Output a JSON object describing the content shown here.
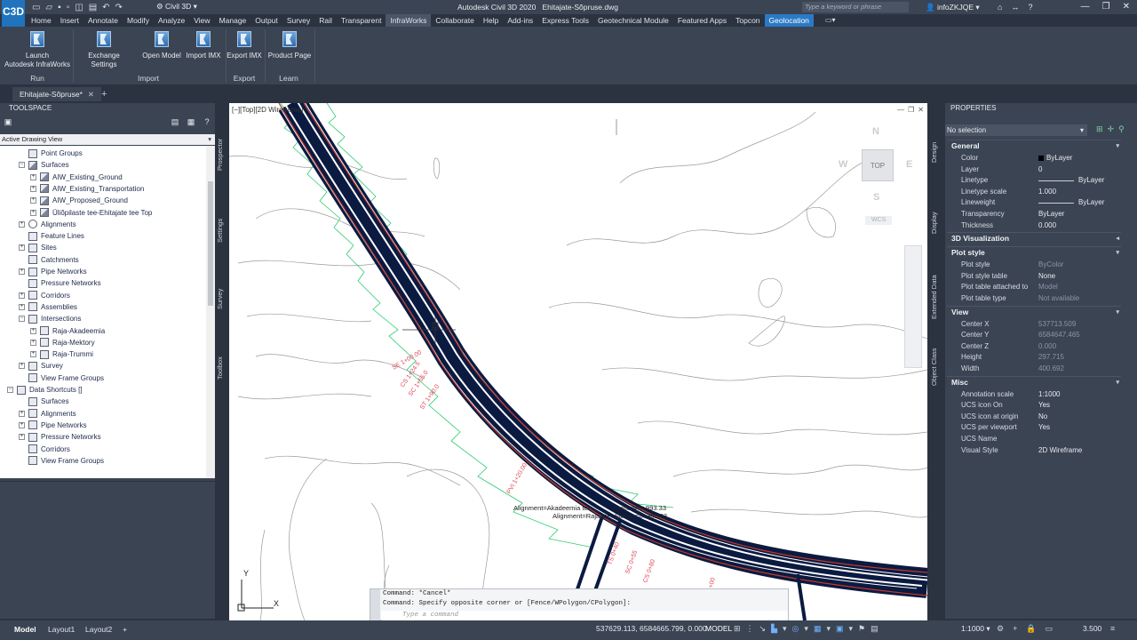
{
  "app": {
    "logo": "C3D",
    "workspace": "Civil 3D",
    "title": "Autodesk Civil 3D 2020",
    "document": "Ehitajate-Sõpruse.dwg",
    "search_placeholder": "Type a keyword or phrase",
    "user": "infoZKJQE"
  },
  "menu": [
    "Home",
    "Insert",
    "Annotate",
    "Modify",
    "Analyze",
    "View",
    "Manage",
    "Output",
    "Survey",
    "Rail",
    "Transparent",
    "InfraWorks",
    "Collaborate",
    "Help",
    "Add-ins",
    "Express Tools",
    "Geotechnical Module",
    "Featured Apps",
    "Topcon",
    "Geolocation"
  ],
  "menu_active": "InfraWorks",
  "ribbon": {
    "buttons": [
      {
        "label1": "Launch",
        "label2": "Autodesk InfraWorks"
      },
      {
        "label1": "Exchange Settings",
        "label2": ""
      },
      {
        "label1": "Open Model",
        "label2": ""
      },
      {
        "label1": "Import IMX",
        "label2": ""
      },
      {
        "label1": "Export IMX",
        "label2": ""
      },
      {
        "label1": "Product Page",
        "label2": ""
      }
    ],
    "groups": [
      "Run",
      "Import",
      "Export",
      "Learn"
    ]
  },
  "doc_tab": {
    "label": "Ehitajate-Sõpruse*",
    "close": "✕",
    "add": "+"
  },
  "toolspace": {
    "title": "TOOLSPACE",
    "view_select": "Active Drawing View",
    "tree": [
      {
        "indent": 1,
        "label": "Point Groups",
        "icon": "box",
        "exp": ""
      },
      {
        "indent": 1,
        "label": "Surfaces",
        "icon": "surf",
        "exp": "⊟"
      },
      {
        "indent": 2,
        "label": "AIW_Existing_Ground",
        "icon": "surf",
        "exp": "⊞"
      },
      {
        "indent": 2,
        "label": "AIW_Existing_Transportation",
        "icon": "surf",
        "exp": "⊞"
      },
      {
        "indent": 2,
        "label": "AIW_Proposed_Ground",
        "icon": "surf",
        "exp": "⊞"
      },
      {
        "indent": 2,
        "label": "Üliõpilaste tee-Ehitajate tee Top",
        "icon": "surf",
        "exp": "⊞"
      },
      {
        "indent": 1,
        "label": "Alignments",
        "icon": "al",
        "exp": "⊞"
      },
      {
        "indent": 1,
        "label": "Feature Lines",
        "icon": "box",
        "exp": ""
      },
      {
        "indent": 1,
        "label": "Sites",
        "icon": "box",
        "exp": "⊞"
      },
      {
        "indent": 1,
        "label": "Catchments",
        "icon": "box",
        "exp": ""
      },
      {
        "indent": 1,
        "label": "Pipe Networks",
        "icon": "box",
        "exp": "⊞"
      },
      {
        "indent": 1,
        "label": "Pressure Networks",
        "icon": "box",
        "exp": ""
      },
      {
        "indent": 1,
        "label": "Corridors",
        "icon": "box",
        "exp": "⊞"
      },
      {
        "indent": 1,
        "label": "Assemblies",
        "icon": "box",
        "exp": "⊞"
      },
      {
        "indent": 1,
        "label": "Intersections",
        "icon": "box",
        "exp": "⊟"
      },
      {
        "indent": 2,
        "label": "Raja-Akadeemia",
        "icon": "box",
        "exp": "⊞"
      },
      {
        "indent": 2,
        "label": "Raja-Mektory",
        "icon": "box",
        "exp": "⊞"
      },
      {
        "indent": 2,
        "label": "Raja-Trummi",
        "icon": "box",
        "exp": "⊞"
      },
      {
        "indent": 1,
        "label": "Survey",
        "icon": "box",
        "exp": "⊞"
      },
      {
        "indent": 1,
        "label": "View Frame Groups",
        "icon": "box",
        "exp": ""
      },
      {
        "indent": 0,
        "label": "Data Shortcuts []",
        "icon": "box",
        "exp": "⊟"
      },
      {
        "indent": 1,
        "label": "Surfaces",
        "icon": "box",
        "exp": ""
      },
      {
        "indent": 1,
        "label": "Alignments",
        "icon": "box",
        "exp": "⊞"
      },
      {
        "indent": 1,
        "label": "Pipe Networks",
        "icon": "box",
        "exp": "⊞"
      },
      {
        "indent": 1,
        "label": "Pressure Networks",
        "icon": "box",
        "exp": "⊞"
      },
      {
        "indent": 1,
        "label": "Corridors",
        "icon": "box",
        "exp": ""
      },
      {
        "indent": 1,
        "label": "View Frame Groups",
        "icon": "box",
        "exp": ""
      }
    ],
    "side_tabs": [
      "Prospector",
      "Settings",
      "Survey",
      "Toolbox"
    ]
  },
  "viewport": {
    "label": "[−][Top][2D Wireframe]",
    "viewcube": {
      "top": "TOP",
      "n": "N",
      "s": "S",
      "e": "E",
      "w": "W"
    },
    "wcs": "WCS",
    "annotation_1": "Alignment=Akadeemia tee",
    "annotation_1b": "Station=0+993.33",
    "annotation_2": "Alignment=Raja tee",
    "annotation_2b": "Station=0+300.03",
    "ucs_y": "Y",
    "ucs_x": "X"
  },
  "command": {
    "history": [
      "Command: *Cancel*",
      "Command: Specify opposite corner or [Fence/WPolygon/CPolygon]:"
    ],
    "placeholder": "Type a command"
  },
  "properties": {
    "title": "PROPERTIES",
    "selection": "No selection",
    "side_tabs": [
      "Design",
      "Display",
      "Extended Data",
      "Object Class"
    ],
    "sections": [
      {
        "name": "General",
        "rows": [
          {
            "k": "Color",
            "v": "ByLayer",
            "dim": false
          },
          {
            "k": "Layer",
            "v": "0",
            "dim": false
          },
          {
            "k": "Linetype",
            "v": "ByLayer",
            "dim": false
          },
          {
            "k": "Linetype scale",
            "v": "1.000",
            "dim": false
          },
          {
            "k": "Lineweight",
            "v": "ByLayer",
            "dim": false
          },
          {
            "k": "Transparency",
            "v": "ByLayer",
            "dim": false
          },
          {
            "k": "Thickness",
            "v": "0.000",
            "dim": false
          }
        ]
      },
      {
        "name": "3D Visualization",
        "rows": []
      },
      {
        "name": "Plot style",
        "rows": [
          {
            "k": "Plot style",
            "v": "ByColor",
            "dim": true
          },
          {
            "k": "Plot style table",
            "v": "None",
            "dim": false
          },
          {
            "k": "Plot table attached to",
            "v": "Model",
            "dim": true
          },
          {
            "k": "Plot table type",
            "v": "Not available",
            "dim": true
          }
        ]
      },
      {
        "name": "View",
        "rows": [
          {
            "k": "Center X",
            "v": "537713.509",
            "dim": true
          },
          {
            "k": "Center Y",
            "v": "6584647.465",
            "dim": true
          },
          {
            "k": "Center Z",
            "v": "0.000",
            "dim": true
          },
          {
            "k": "Height",
            "v": "297.715",
            "dim": true
          },
          {
            "k": "Width",
            "v": "400.692",
            "dim": true
          }
        ]
      },
      {
        "name": "Misc",
        "rows": [
          {
            "k": "Annotation scale",
            "v": "1:1000",
            "dim": false
          },
          {
            "k": "UCS icon On",
            "v": "Yes",
            "dim": false
          },
          {
            "k": "UCS icon at origin",
            "v": "No",
            "dim": false
          },
          {
            "k": "UCS per viewport",
            "v": "Yes",
            "dim": false
          },
          {
            "k": "UCS Name",
            "v": "",
            "dim": false
          },
          {
            "k": "Visual Style",
            "v": "2D Wireframe",
            "dim": false
          }
        ]
      }
    ]
  },
  "status": {
    "tabs": [
      "Model",
      "Layout1",
      "Layout2"
    ],
    "add": "+",
    "coords": "537629.113, 6584665.799, 0.000",
    "model": "MODEL",
    "scale": "1:1000 ▾",
    "value": "3.500"
  }
}
